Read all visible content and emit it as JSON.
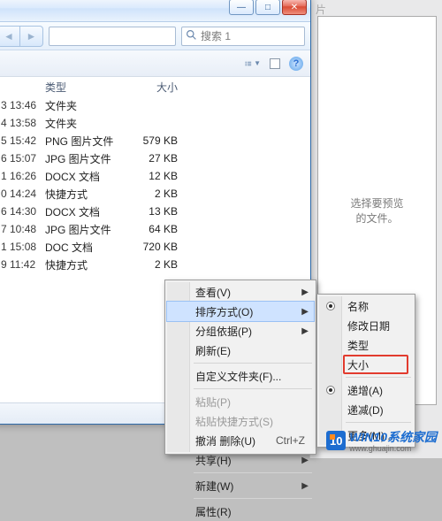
{
  "bg": {
    "preview_text": "选择要预览\n的文件。",
    "tab_hint": "片"
  },
  "window": {
    "buttons": {
      "min": "—",
      "max": "□",
      "close": "✕"
    },
    "search_placeholder": "搜索 1",
    "columns": {
      "type": "类型",
      "size": "大小"
    },
    "rows": [
      {
        "date": "3 13:46",
        "type": "文件夹",
        "size": ""
      },
      {
        "date": "4 13:58",
        "type": "文件夹",
        "size": ""
      },
      {
        "date": "5 15:42",
        "type": "PNG 图片文件",
        "size": "579 KB"
      },
      {
        "date": "6 15:07",
        "type": "JPG 图片文件",
        "size": "27 KB"
      },
      {
        "date": "1 16:26",
        "type": "DOCX 文档",
        "size": "12 KB"
      },
      {
        "date": "0 14:24",
        "type": "快捷方式",
        "size": "2 KB"
      },
      {
        "date": "6 14:30",
        "type": "DOCX 文档",
        "size": "13 KB"
      },
      {
        "date": "7 10:48",
        "type": "JPG 图片文件",
        "size": "64 KB"
      },
      {
        "date": "1 15:08",
        "type": "DOC 文档",
        "size": "720 KB"
      },
      {
        "date": "9 11:42",
        "type": "快捷方式",
        "size": "2 KB"
      }
    ]
  },
  "context_menu": {
    "view": "查看(V)",
    "sort": "排序方式(O)",
    "group": "分组依据(P)",
    "refresh": "刷新(E)",
    "customize": "自定义文件夹(F)...",
    "paste": "粘贴(P)",
    "paste_shortcut": "粘贴快捷方式(S)",
    "undo": "撤消 删除(U)",
    "undo_key": "Ctrl+Z",
    "share": "共享(H)",
    "new": "新建(W)",
    "properties": "属性(R)"
  },
  "sort_menu": {
    "name": "名称",
    "date": "修改日期",
    "type": "类型",
    "size": "大小",
    "asc": "递增(A)",
    "desc": "递减(D)",
    "more": "更多(M)..."
  },
  "watermark": {
    "badge": "10",
    "line1": "WIN10系统家园",
    "line2": "www.ghuajin.com"
  }
}
